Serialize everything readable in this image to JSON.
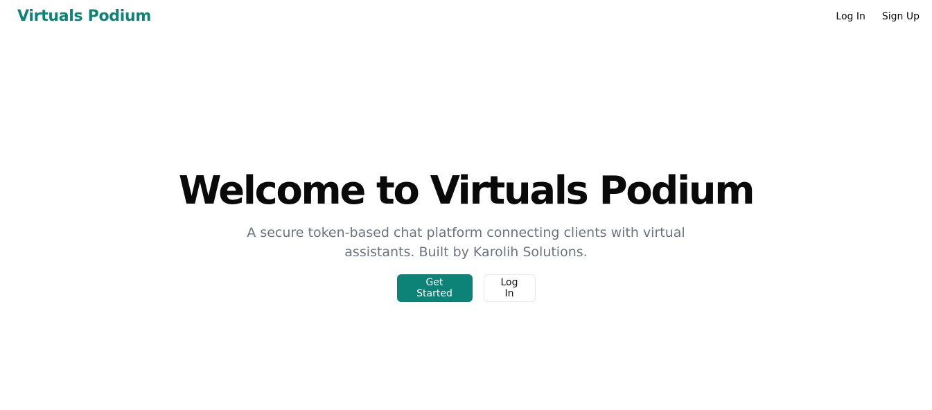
{
  "header": {
    "brand": "Virtuals Podium",
    "nav": {
      "login_label": "Log In",
      "signup_label": "Sign Up"
    }
  },
  "hero": {
    "title": "Welcome to Virtuals Podium",
    "subtitle": "A secure token-based chat platform connecting clients with virtual assistants. Built by Karolih Solutions.",
    "primary_button": "Get Started",
    "secondary_button": "Log In"
  },
  "colors": {
    "brand": "#0d8276",
    "text": "#0a0a0a",
    "muted_text": "#6b7280",
    "border": "#e5e7eb"
  }
}
